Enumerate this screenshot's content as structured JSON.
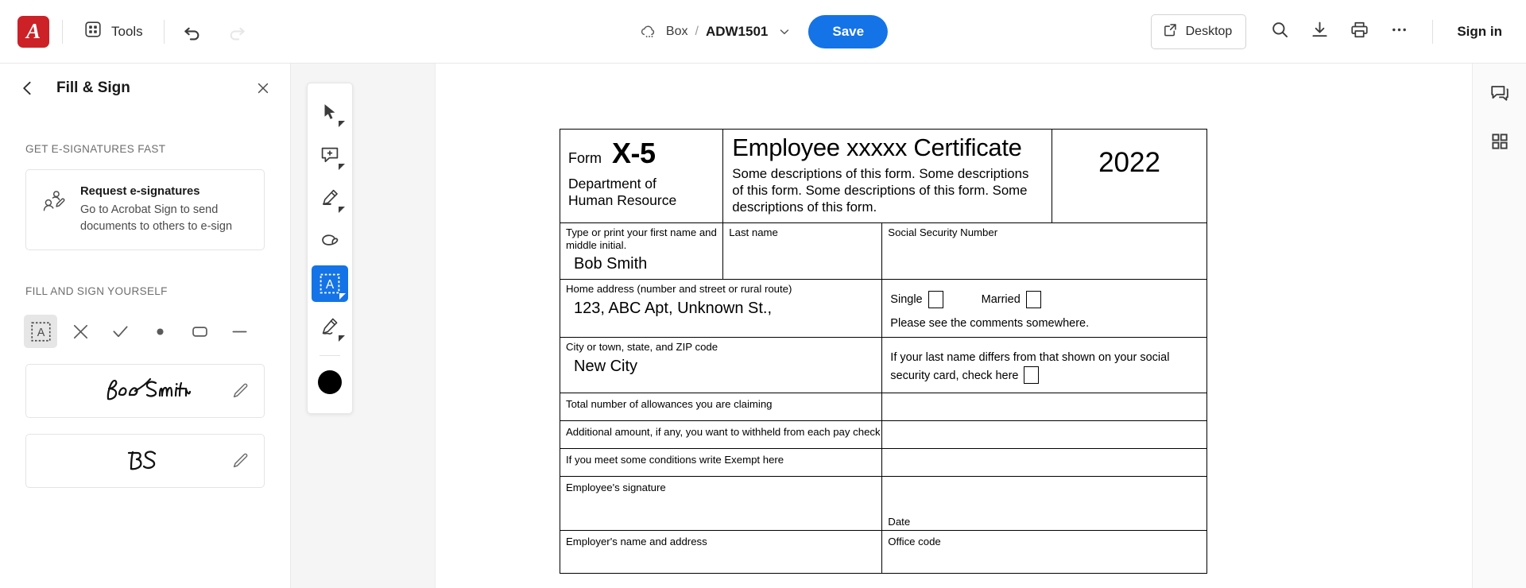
{
  "topbar": {
    "logo_alt": "adobe-acrobat-logo",
    "tools_label": "Tools",
    "undo_icon": "undo-icon",
    "redo_icon": "redo-icon",
    "storage_label": "Box",
    "separator": "/",
    "file_name": "ADW1501",
    "save_label": "Save",
    "desktop_label": "Desktop",
    "search_icon": "search-icon",
    "download_icon": "download-icon",
    "print_icon": "print-icon",
    "more_icon": "more-options-icon",
    "signin_label": "Sign in",
    "accent_blue": "#1473e6",
    "brand_red": "#cc2127"
  },
  "panel": {
    "title": "Fill & Sign",
    "back_icon": "back-chevron-icon",
    "close_icon": "close-icon",
    "section_esign": "GET E-SIGNATURES FAST",
    "esign_card": {
      "title": "Request e-signatures",
      "subtitle": "Go to Acrobat Sign to send documents to others to e-sign",
      "icon": "request-signatures-icon"
    },
    "section_fill": "FILL AND SIGN YOURSELF",
    "tools": [
      {
        "name": "add-text-tool",
        "glyph": "A",
        "active": true
      },
      {
        "name": "cross-mark-tool",
        "glyph": "X",
        "active": false
      },
      {
        "name": "check-mark-tool",
        "glyph": "check",
        "active": false
      },
      {
        "name": "dot-tool",
        "glyph": "dot",
        "active": false
      },
      {
        "name": "rounded-rect-tool",
        "glyph": "rect",
        "active": false
      },
      {
        "name": "line-tool",
        "glyph": "dash",
        "active": false
      }
    ],
    "signatures": [
      {
        "name": "signature-bob-smith",
        "label": "Bob Smith",
        "edit_icon": "edit-pen-icon"
      },
      {
        "name": "initials-bs",
        "label": "BS",
        "edit_icon": "edit-pen-icon"
      }
    ]
  },
  "vtoolbar": {
    "items": [
      {
        "name": "select-tool",
        "icon": "cursor-arrow-icon",
        "selected": false,
        "has_caret": true
      },
      {
        "name": "add-comment-tool",
        "icon": "comment-plus-icon",
        "selected": false,
        "has_caret": true
      },
      {
        "name": "highlight-tool",
        "icon": "highlighter-icon",
        "selected": false,
        "has_caret": true
      },
      {
        "name": "draw-loop-tool",
        "icon": "lasso-loop-icon",
        "selected": false,
        "has_caret": false
      },
      {
        "name": "add-text-tool",
        "icon": "text-box-icon",
        "selected": true,
        "has_caret": true
      },
      {
        "name": "sign-tool",
        "icon": "signature-pen-icon",
        "selected": false,
        "has_caret": true
      }
    ],
    "color_swatch": "#000000",
    "color_name": "color-swatch-black"
  },
  "rightbar": {
    "items": [
      {
        "name": "comments-panel-icon",
        "icon": "comment-bubble-icon"
      },
      {
        "name": "all-tools-panel-icon",
        "icon": "grid-apps-icon"
      }
    ]
  },
  "document": {
    "header": {
      "form_label": "Form",
      "form_number": "X-5",
      "department": "Department of\nHuman Resource",
      "department_line1": "Department of",
      "department_line2": "Human Resource",
      "title": "Employee xxxxx Certificate",
      "description": "Some descriptions of this form. Some descriptions of this form. Some descriptions of this form. Some descriptions of this form.",
      "year": "2022"
    },
    "rows": {
      "first_name_caption": "Type or print your first name and middle initial.",
      "first_name_value": "Bob Smith",
      "last_name_caption": "Last name",
      "last_name_value": "",
      "ssn_caption": "Social Security Number",
      "ssn_value": "",
      "home_address_caption": "Home address (number and street or rural route)",
      "home_address_value": "123, ABC Apt, Unknown St.,",
      "single_label": "Single",
      "married_label": "Married",
      "comment_note": "Please see the comments somewhere.",
      "city_caption": "City or town, state, and ZIP code",
      "city_value": "New City",
      "name_differs_note": "If your last name differs from that shown on your social security card, check here",
      "allowances_caption": "Total number of allowances you are claiming",
      "allowances_value": "",
      "additional_amount_caption": "Additional amount, if any, you want to withheld from each pay check",
      "additional_amount_value": "",
      "exempt_caption": "If you meet some conditions write Exempt here",
      "exempt_value": "",
      "employee_signature_caption": "Employee's signature",
      "date_caption": "Date",
      "employer_caption": "Employer's name and address",
      "office_code_caption": "Office code"
    }
  }
}
